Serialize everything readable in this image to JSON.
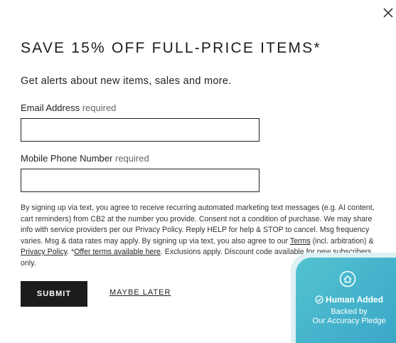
{
  "modal": {
    "close_label": "×",
    "headline": "SAVE 15% OFF FULL-PRICE ITEMS*",
    "subheadline": "Get alerts about new items, sales and more.",
    "email": {
      "label": "Email Address",
      "required": "required",
      "value": "",
      "placeholder": ""
    },
    "phone": {
      "label": "Mobile Phone Number",
      "required": "required",
      "value": "",
      "placeholder": ""
    },
    "legal": {
      "part1": "By signing up via text, you agree to receive recurring automated marketing text messages (e.g. AI content, cart reminders) from CB2 at the number you provide. Consent not a condition of purchase. We may share info with service providers per our Privacy Policy. Reply HELP for help & STOP to cancel. Msg frequency varies. Msg & data rates may apply. By signing up via text, you also agree to our ",
      "terms_link": "Terms",
      "part2": " (incl. arbitration) & ",
      "privacy_link": "Privacy Policy",
      "part3": ". *",
      "offer_link": "Offer terms available here",
      "part4": ". Exclusions apply. Discount code available for new subscribers only."
    },
    "submit_label": "SUBMIT",
    "maybe_later_label": "MAYBE LATER"
  },
  "badge": {
    "title": "Human Added",
    "line1": "Backed by",
    "line2": "Our Accuracy Pledge",
    "color": "#46b4cc"
  }
}
